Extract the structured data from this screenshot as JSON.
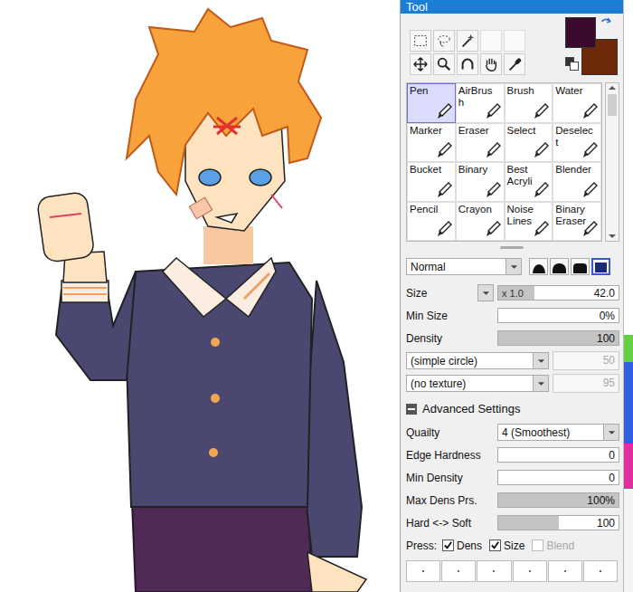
{
  "window": {
    "title": "Tool"
  },
  "colors": {
    "primary": "#3b0b2d",
    "secondary": "#6e2a08"
  },
  "tools": [
    {
      "label": "Pen",
      "selected": true
    },
    {
      "label": "AirBrush",
      "selected": false
    },
    {
      "label": "Brush",
      "selected": false
    },
    {
      "label": "Water",
      "selected": false
    },
    {
      "label": "Marker",
      "selected": false
    },
    {
      "label": "Eraser",
      "selected": false
    },
    {
      "label": "Select",
      "selected": false
    },
    {
      "label": "Deselect",
      "selected": false
    },
    {
      "label": "Bucket",
      "selected": false
    },
    {
      "label": "Binary",
      "selected": false
    },
    {
      "label": "Best Acryli",
      "selected": false
    },
    {
      "label": "Blender",
      "selected": false
    },
    {
      "label": "Pencil",
      "selected": false
    },
    {
      "label": "Crayon",
      "selected": false
    },
    {
      "label": "Noise Lines",
      "selected": false
    },
    {
      "label": "Binary Eraser",
      "selected": false
    }
  ],
  "blend_mode": "Normal",
  "brush_shapes": [
    {
      "selected": false
    },
    {
      "selected": false
    },
    {
      "selected": false
    },
    {
      "selected": true
    }
  ],
  "size": {
    "label": "Size",
    "multiplier": "x 1.0",
    "value": "42.0",
    "level": 0.3
  },
  "basic_sliders": [
    {
      "label": "Min Size",
      "value": "0%",
      "level": 0
    },
    {
      "label": "Density",
      "value": "100",
      "level": 1
    }
  ],
  "shape": {
    "value": "(simple circle)",
    "amount": "50",
    "disabled": true
  },
  "texture": {
    "value": "(no texture)",
    "amount": "95",
    "disabled": true
  },
  "advanced": {
    "label": "Advanced Settings",
    "expanded": true,
    "quality": {
      "label": "Quailty",
      "value": "4 (Smoothest)"
    },
    "sliders": [
      {
        "label": "Edge Hardness",
        "value": "0",
        "level": 0
      },
      {
        "label": "Min Density",
        "value": "0",
        "level": 0
      },
      {
        "label": "Max Dens Prs.",
        "value": "100%",
        "level": 1
      },
      {
        "label": "Hard <-> Soft",
        "value": "100",
        "level": 0.5
      }
    ]
  },
  "pressure": {
    "label": "Press:",
    "options": [
      {
        "label": "Dens",
        "checked": true,
        "disabled": false
      },
      {
        "label": "Size",
        "checked": true,
        "disabled": false
      },
      {
        "label": "Blend",
        "checked": false,
        "disabled": true
      }
    ]
  }
}
